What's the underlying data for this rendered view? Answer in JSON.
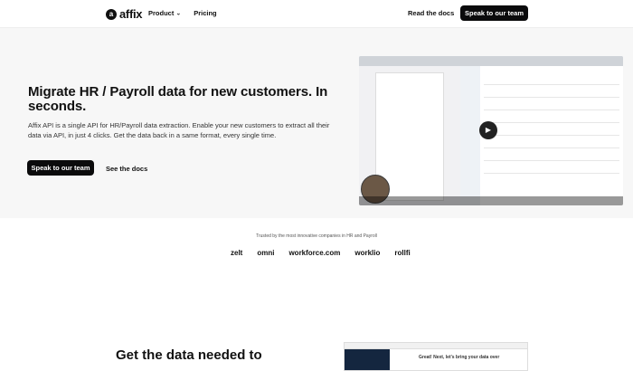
{
  "nav": {
    "brand": "affix",
    "items": [
      {
        "label": "Product",
        "has_chevron": true
      },
      {
        "label": "Pricing"
      }
    ],
    "docs_link": "Read the docs",
    "cta": "Speak to our team"
  },
  "hero": {
    "title": "Migrate HR / Payroll data for new customers. In seconds.",
    "subtitle": "Affix API is a single API for HR/Payroll data extraction. Enable your new customers to extract all their data via API, in just 4 clicks. Get the data back in a same format, every single time.",
    "cta_primary": "Speak to our team",
    "cta_secondary": "See the docs"
  },
  "trusted": {
    "label": "Trusted by the most innovative companies in HR and Payroll",
    "logos": [
      "zelt",
      "omni",
      "workforce.com",
      "worklio",
      "rollfi"
    ]
  },
  "section": {
    "heading": "Get the data needed to",
    "preview_text": "Great! Next, let's bring your data over"
  },
  "colors": {
    "primary": "#0b0b0c",
    "hero_bg": "#f7f7f7"
  }
}
